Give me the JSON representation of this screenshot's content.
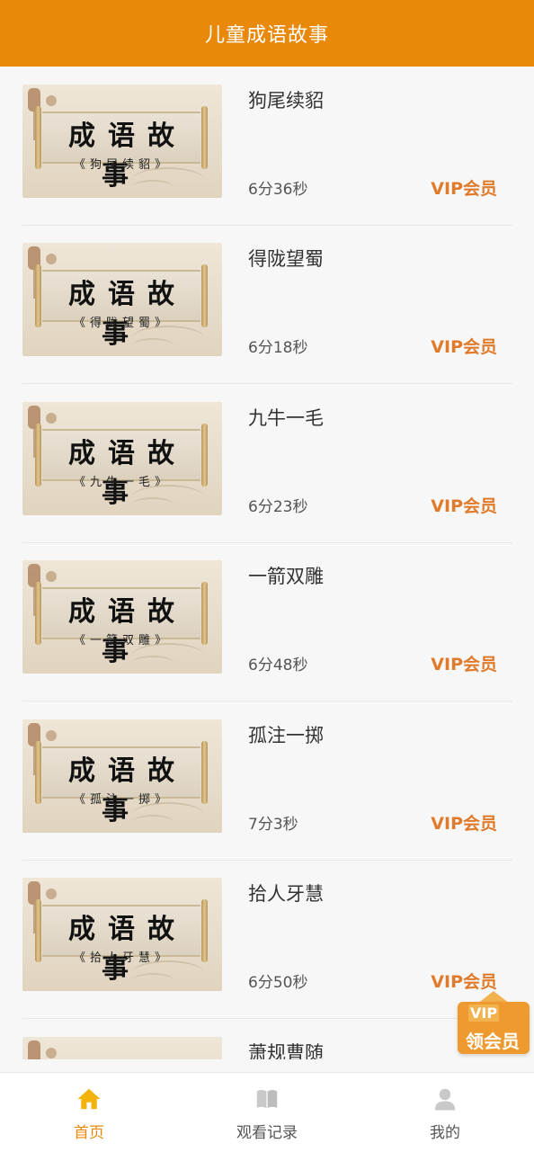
{
  "header": {
    "title": "儿童成语故事"
  },
  "thumb_common": {
    "scroll_title": "成语故事"
  },
  "stories": [
    {
      "title": "狗尾续貂",
      "thumb_subtitle": "《狗尾续貂》",
      "duration": "6分36秒",
      "badge": "VIP会员"
    },
    {
      "title": "得陇望蜀",
      "thumb_subtitle": "《得陇望蜀》",
      "duration": "6分18秒",
      "badge": "VIP会员"
    },
    {
      "title": "九牛一毛",
      "thumb_subtitle": "《九牛一毛》",
      "duration": "6分23秒",
      "badge": "VIP会员"
    },
    {
      "title": "一箭双雕",
      "thumb_subtitle": "《一箭双雕》",
      "duration": "6分48秒",
      "badge": "VIP会员"
    },
    {
      "title": "孤注一掷",
      "thumb_subtitle": "《孤注一掷》",
      "duration": "7分3秒",
      "badge": "VIP会员"
    },
    {
      "title": "拾人牙慧",
      "thumb_subtitle": "《拾人牙慧》",
      "duration": "6分50秒",
      "badge": "VIP会员"
    },
    {
      "title": "萧规曹随",
      "thumb_subtitle": "",
      "duration": "",
      "badge": ""
    }
  ],
  "vip_float": {
    "top_text": "VIP",
    "label": "领会员"
  },
  "tabbar": {
    "items": [
      {
        "label": "首页",
        "icon": "home-icon",
        "active": true
      },
      {
        "label": "观看记录",
        "icon": "book-icon",
        "active": false
      },
      {
        "label": "我的",
        "icon": "user-icon",
        "active": false
      }
    ]
  },
  "colors": {
    "accent": "#e8890a",
    "vip": "#e07b2c"
  }
}
